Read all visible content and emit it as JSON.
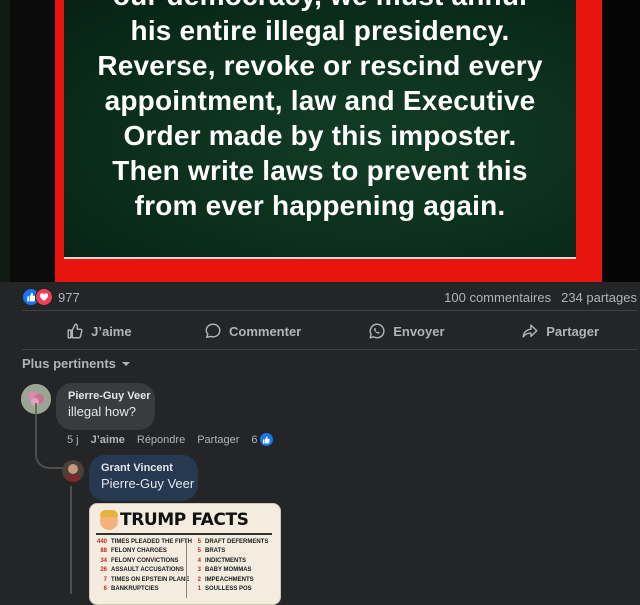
{
  "post_image": {
    "lines": "our democracy, we must annul\nhis entire illegal presidency.\nReverse, revoke or rescind every\nappointment, law and Executive\nOrder made by this imposter.\nThen write laws to prevent this\nfrom ever happening again."
  },
  "reactions": {
    "count": "977",
    "icons": [
      "like-icon",
      "love-icon"
    ],
    "colors": {
      "like": "#1877f2",
      "love": "#f33e58"
    }
  },
  "stats": {
    "comments": "100 commentaires",
    "shares": "234 partages"
  },
  "actions": {
    "like": "J’aime",
    "comment": "Commenter",
    "send": "Envoyer",
    "share": "Partager"
  },
  "filter": {
    "label": "Plus pertinents"
  },
  "comments": [
    {
      "author": "Pierre-Guy Veer",
      "text": "illegal how?",
      "time": "5 j",
      "like": "J’aime",
      "reply": "Répondre",
      "share": "Partager",
      "reactions": "6"
    },
    {
      "author": "Grant Vincent",
      "text": "Pierre-Guy Veer"
    }
  ],
  "facts_card": {
    "title": "TRUMP FACTS",
    "left": [
      {
        "n": "440",
        "t": "TIMES PLEADED THE FIFTH"
      },
      {
        "n": "88",
        "t": "FELONY CHARGES"
      },
      {
        "n": "34",
        "t": "FELONY CONVICTIONS"
      },
      {
        "n": "26",
        "t": "ASSAULT ACCUSATIONS"
      },
      {
        "n": "7",
        "t": "TIMES ON EPSTEIN PLANE"
      },
      {
        "n": "6",
        "t": "BANKRUPTCIES"
      }
    ],
    "right": [
      {
        "n": "5",
        "t": "DRAFT DEFERMENTS"
      },
      {
        "n": "5",
        "t": "BRATS"
      },
      {
        "n": "4",
        "t": "INDICTMENTS"
      },
      {
        "n": "3",
        "t": "BABY MOMMAS"
      },
      {
        "n": "2",
        "t": "IMPEACHMENTS"
      },
      {
        "n": "1",
        "t": "SOULLESS POS"
      }
    ]
  }
}
